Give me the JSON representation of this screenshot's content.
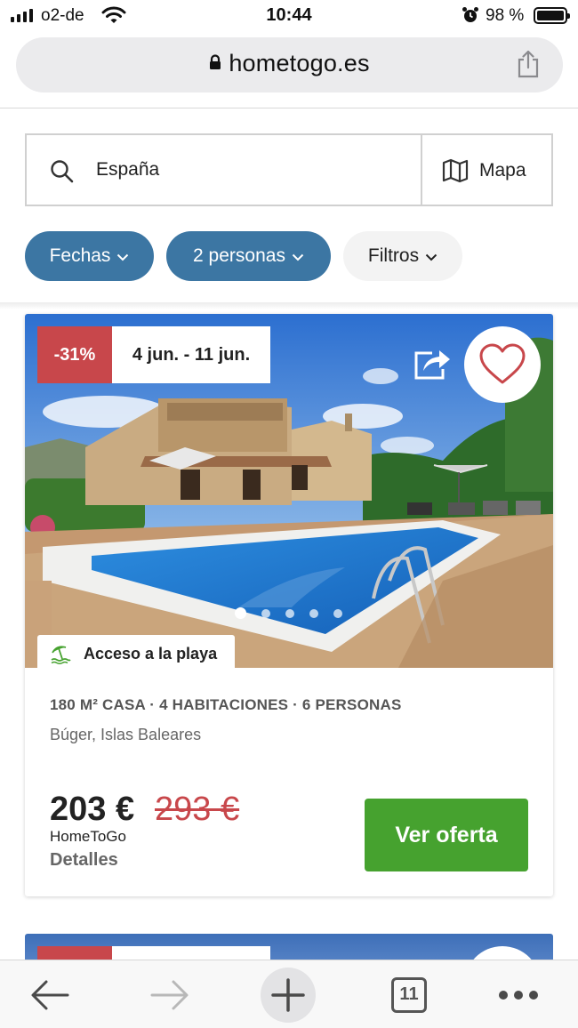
{
  "status_bar": {
    "carrier": "o2-de",
    "time": "10:44",
    "battery": "98 %"
  },
  "browser": {
    "url": "hometogo.es",
    "tab_count": "11"
  },
  "search": {
    "value": "España",
    "map_label": "Mapa"
  },
  "filters": [
    {
      "label": "Fechas",
      "active": true
    },
    {
      "label": "2 personas",
      "active": true
    },
    {
      "label": "Filtros",
      "active": false
    }
  ],
  "listing": {
    "discount": "-31%",
    "dates": "4 jun. - 11 jun.",
    "badge": "Acceso a la playa",
    "specs": "180 M² CASA · 4 HABITACIONES · 6 PERSONAS",
    "location": "Búger, Islas Baleares",
    "price": "203 €",
    "old_price": "293 €",
    "provider": "HomeToGo",
    "details_label": "Detalles",
    "cta_label": "Ver oferta",
    "carousel_dots": 5,
    "carousel_active": 1
  },
  "colors": {
    "pill_active": "#3c76a3",
    "discount": "#c8474b",
    "cta": "#46a22f"
  },
  "icons": [
    "signal-icon",
    "wifi-icon",
    "alarm-icon",
    "battery-icon",
    "lock-icon",
    "share-icon",
    "search-icon",
    "map-icon",
    "chevron-down-icon",
    "heart-icon",
    "beach-umbrella-icon",
    "back-arrow-icon",
    "forward-arrow-icon",
    "plus-icon",
    "tabs-icon",
    "more-icon"
  ]
}
